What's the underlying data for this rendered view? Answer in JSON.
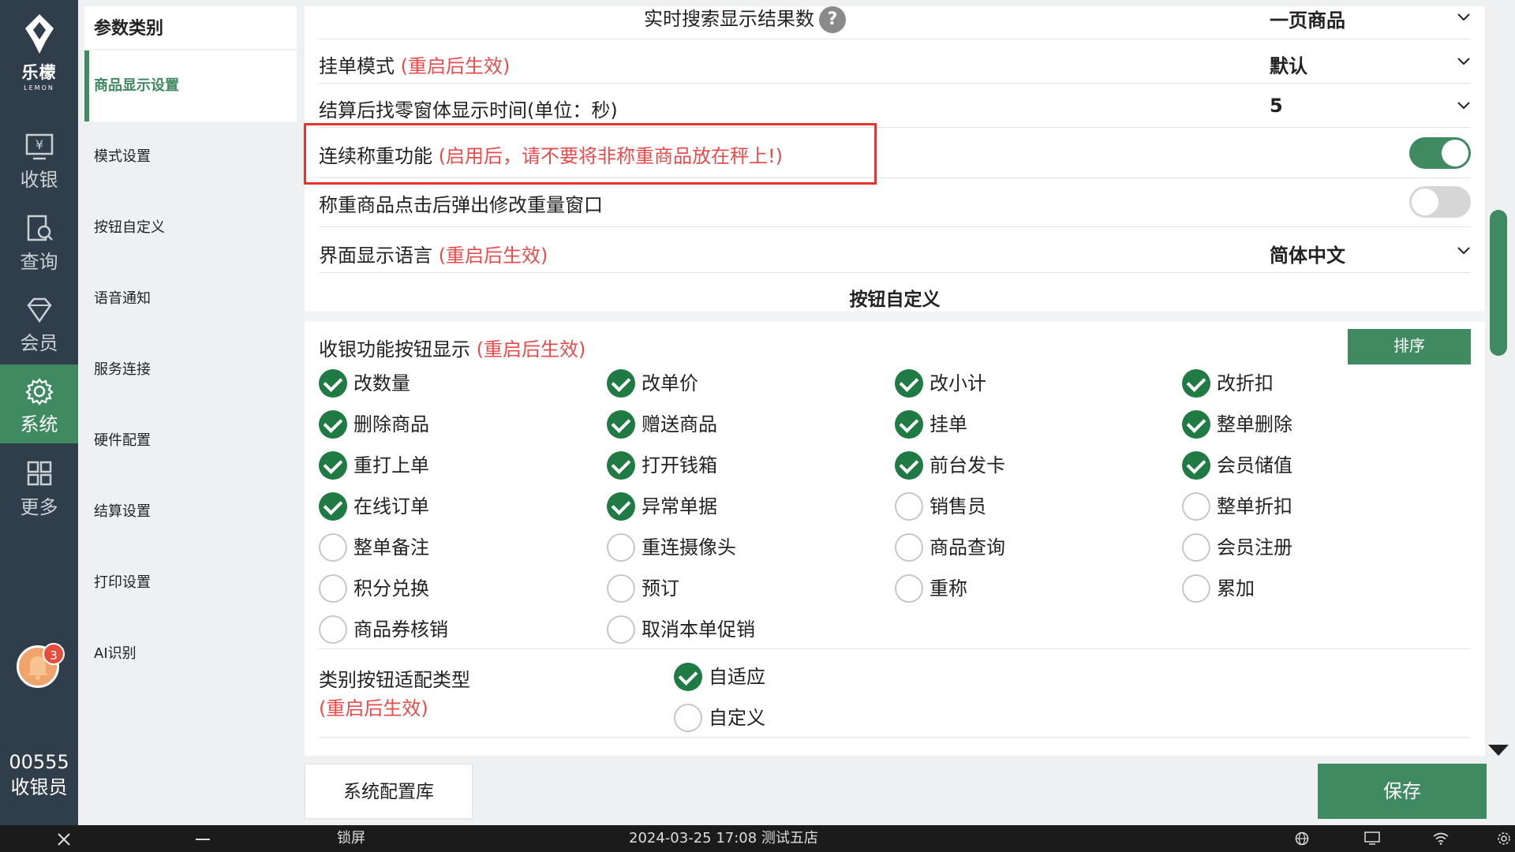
{
  "brand": {
    "name": "乐檬",
    "name_en": "LEMON"
  },
  "rail": [
    {
      "label": "收银",
      "icon": "cashier-icon"
    },
    {
      "label": "查询",
      "icon": "query-icon"
    },
    {
      "label": "会员",
      "icon": "member-icon"
    },
    {
      "label": "系统",
      "icon": "gear-icon",
      "active": true
    },
    {
      "label": "更多",
      "icon": "grid-icon"
    }
  ],
  "notifications": {
    "count": "3"
  },
  "user": {
    "code": "00555",
    "role": "收银员"
  },
  "categories": {
    "header": "参数类别",
    "items": [
      "商品显示设置",
      "模式设置",
      "按钮自定义",
      "语音通知",
      "服务连接",
      "硬件配置",
      "结算设置",
      "打印设置",
      "AI识别"
    ]
  },
  "settings": {
    "realtime_search": {
      "label": "实时搜索显示结果数",
      "value": "一页商品"
    },
    "hang_mode": {
      "label": "挂单模式",
      "note": "(重启后生效)",
      "value": "默认"
    },
    "change_window": {
      "label": "结算后找零窗体显示时间(单位：秒)",
      "value": "5"
    },
    "continuous_weigh": {
      "label": "连续称重功能",
      "note": "(启用后，请不要将非称重商品放在秤上!)",
      "enabled": true
    },
    "weigh_popup": {
      "label": "称重商品点击后弹出修改重量窗口",
      "enabled": false
    },
    "language": {
      "label": "界面显示语言",
      "note": "(重启后生效)",
      "value": "简体中文"
    }
  },
  "button_section": {
    "title": "按钮自定义",
    "cashier_label": "收银功能按钮显示",
    "cashier_note": "(重启后生效)",
    "sort_label": "排序",
    "buttons": [
      {
        "label": "改数量",
        "checked": true
      },
      {
        "label": "改单价",
        "checked": true
      },
      {
        "label": "改小计",
        "checked": true
      },
      {
        "label": "改折扣",
        "checked": true
      },
      {
        "label": "删除商品",
        "checked": true
      },
      {
        "label": "赠送商品",
        "checked": true
      },
      {
        "label": "挂单",
        "checked": true
      },
      {
        "label": "整单删除",
        "checked": true
      },
      {
        "label": "重打上单",
        "checked": true
      },
      {
        "label": "打开钱箱",
        "checked": true
      },
      {
        "label": "前台发卡",
        "checked": true
      },
      {
        "label": "会员储值",
        "checked": true
      },
      {
        "label": "在线订单",
        "checked": true
      },
      {
        "label": "异常单据",
        "checked": true
      },
      {
        "label": "销售员",
        "checked": false
      },
      {
        "label": "整单折扣",
        "checked": false
      },
      {
        "label": "整单备注",
        "checked": false
      },
      {
        "label": "重连摄像头",
        "checked": false
      },
      {
        "label": "商品查询",
        "checked": false
      },
      {
        "label": "会员注册",
        "checked": false
      },
      {
        "label": "积分兑换",
        "checked": false
      },
      {
        "label": "预订",
        "checked": false
      },
      {
        "label": "重称",
        "checked": false
      },
      {
        "label": "累加",
        "checked": false
      },
      {
        "label": "商品券核销",
        "checked": false
      },
      {
        "label": "取消本单促销",
        "checked": false
      }
    ],
    "category_adapt": {
      "label": "类别按钮适配类型",
      "note": "(重启后生效)",
      "options": [
        {
          "label": "自适应",
          "checked": true
        },
        {
          "label": "自定义",
          "checked": false
        }
      ]
    }
  },
  "bottom": {
    "config_lib": "系统配置库",
    "save": "保存"
  },
  "taskbar": {
    "lock": "锁屏",
    "datetime_store": "2024-03-25 17:08  测试五店"
  },
  "colors": {
    "accent": "#3f8a61",
    "rail": "#2f3e4a",
    "warn": "#e84b4b"
  }
}
